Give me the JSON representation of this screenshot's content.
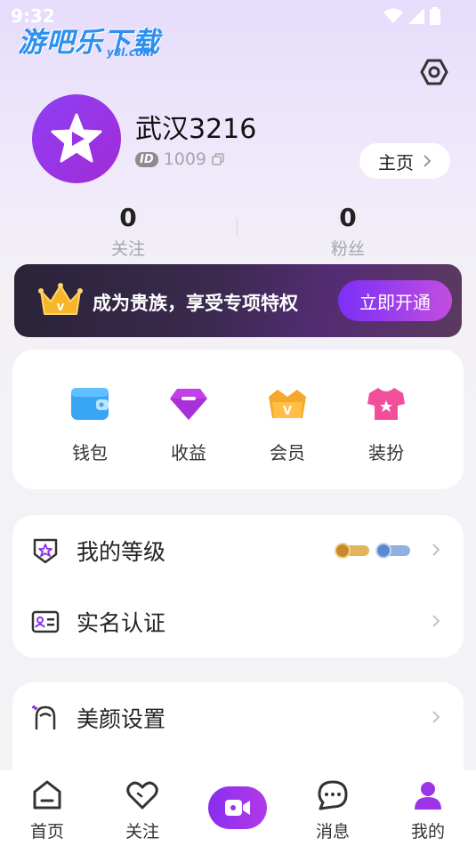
{
  "status_bar": {
    "time": "9:32"
  },
  "watermark": {
    "main": "游吧乐下载",
    "sub": "y8l.com"
  },
  "profile": {
    "username": "武汉3216",
    "id_badge": "ID",
    "id_value": "1009",
    "home_button": "主页"
  },
  "stats": [
    {
      "value": "0",
      "label": "关注"
    },
    {
      "value": "0",
      "label": "粉丝"
    }
  ],
  "vip_banner": {
    "text": "成为贵族，享受专项特权",
    "button": "立即开通"
  },
  "quick_grid": [
    {
      "label": "钱包",
      "icon": "wallet-icon"
    },
    {
      "label": "收益",
      "icon": "diamond-icon"
    },
    {
      "label": "会员",
      "icon": "crown-icon"
    },
    {
      "label": "装扮",
      "icon": "shirt-icon"
    }
  ],
  "menu_group_1": [
    {
      "label": "我的等级",
      "icon": "level-icon"
    },
    {
      "label": "实名认证",
      "icon": "id-card-icon"
    }
  ],
  "menu_group_2": [
    {
      "label": "美颜设置",
      "icon": "beauty-icon"
    }
  ],
  "tabbar": {
    "items": [
      {
        "label": "首页",
        "icon": "home-icon"
      },
      {
        "label": "关注",
        "icon": "heart-icon"
      },
      {
        "label": "",
        "icon": "live-video-icon"
      },
      {
        "label": "消息",
        "icon": "message-icon"
      },
      {
        "label": "我的",
        "icon": "profile-icon"
      }
    ]
  },
  "colors": {
    "accent": "#8a2ef0",
    "active_tab": "#9b33e8"
  }
}
